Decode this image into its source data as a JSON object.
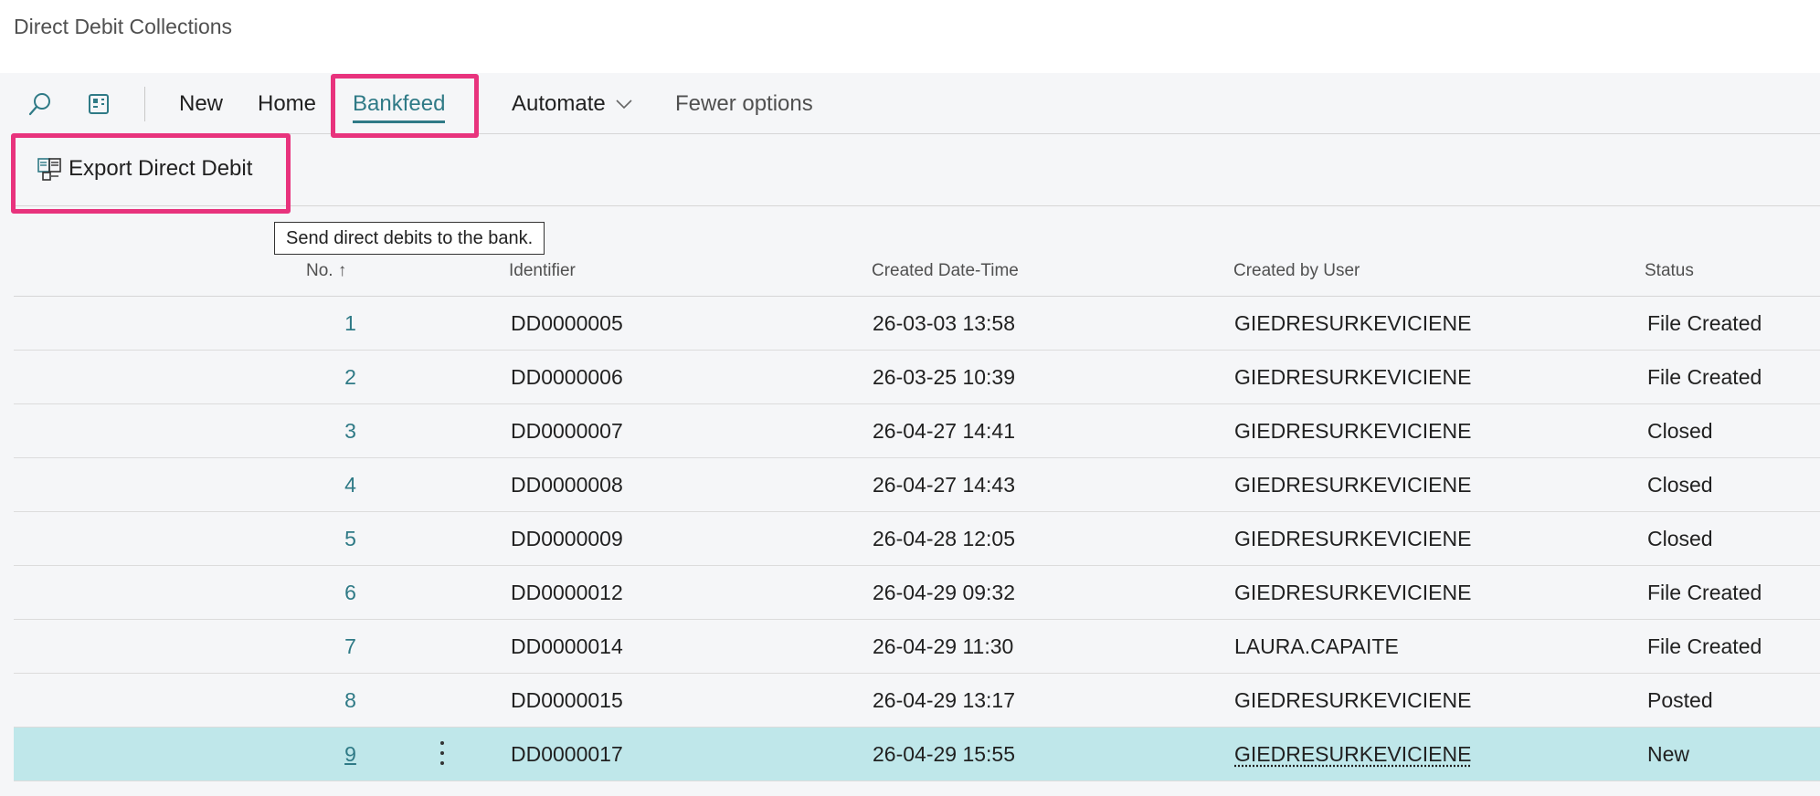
{
  "page": {
    "title": "Direct Debit Collections"
  },
  "action_bar": {
    "search_icon": "search-icon",
    "view_icon": "view-toggle-icon",
    "items": [
      {
        "label": "New"
      },
      {
        "label": "Home"
      },
      {
        "label": "Bankfeed",
        "active": true
      },
      {
        "label": "Automate",
        "has_dropdown": true
      },
      {
        "label": "Fewer options"
      }
    ]
  },
  "promoted_actions": {
    "export_label": "Export Direct Debit",
    "export_icon": "export-document-icon"
  },
  "tooltip": {
    "text": "Send direct debits to the bank."
  },
  "table": {
    "columns": {
      "no": "No. ↑",
      "identifier": "Identifier",
      "created": "Created Date-Time",
      "user": "Created by User",
      "status": "Status"
    },
    "rows": [
      {
        "no": "1",
        "identifier": "DD0000005",
        "created": "26-03-03 13:58",
        "user": "GIEDRESURKEVICIENE",
        "status": "File Created"
      },
      {
        "no": "2",
        "identifier": "DD0000006",
        "created": "26-03-25 10:39",
        "user": "GIEDRESURKEVICIENE",
        "status": "File Created"
      },
      {
        "no": "3",
        "identifier": "DD0000007",
        "created": "26-04-27 14:41",
        "user": "GIEDRESURKEVICIENE",
        "status": "Closed"
      },
      {
        "no": "4",
        "identifier": "DD0000008",
        "created": "26-04-27 14:43",
        "user": "GIEDRESURKEVICIENE",
        "status": "Closed"
      },
      {
        "no": "5",
        "identifier": "DD0000009",
        "created": "26-04-28 12:05",
        "user": "GIEDRESURKEVICIENE",
        "status": "Closed"
      },
      {
        "no": "6",
        "identifier": "DD0000012",
        "created": "26-04-29 09:32",
        "user": "GIEDRESURKEVICIENE",
        "status": "File Created"
      },
      {
        "no": "7",
        "identifier": "DD0000014",
        "created": "26-04-29 11:30",
        "user": "LAURA.CAPAITE",
        "status": "File Created"
      },
      {
        "no": "8",
        "identifier": "DD0000015",
        "created": "26-04-29 13:17",
        "user": "GIEDRESURKEVICIENE",
        "status": "Posted"
      },
      {
        "no": "9",
        "identifier": "DD0000017",
        "created": "26-04-29 15:55",
        "user": "GIEDRESURKEVICIENE",
        "status": "New",
        "selected": true
      }
    ]
  },
  "colors": {
    "accent": "#2f7a86",
    "highlight": "#e8337d",
    "selected_row": "#bfe7ea",
    "content_bg": "#f5f6f8"
  }
}
